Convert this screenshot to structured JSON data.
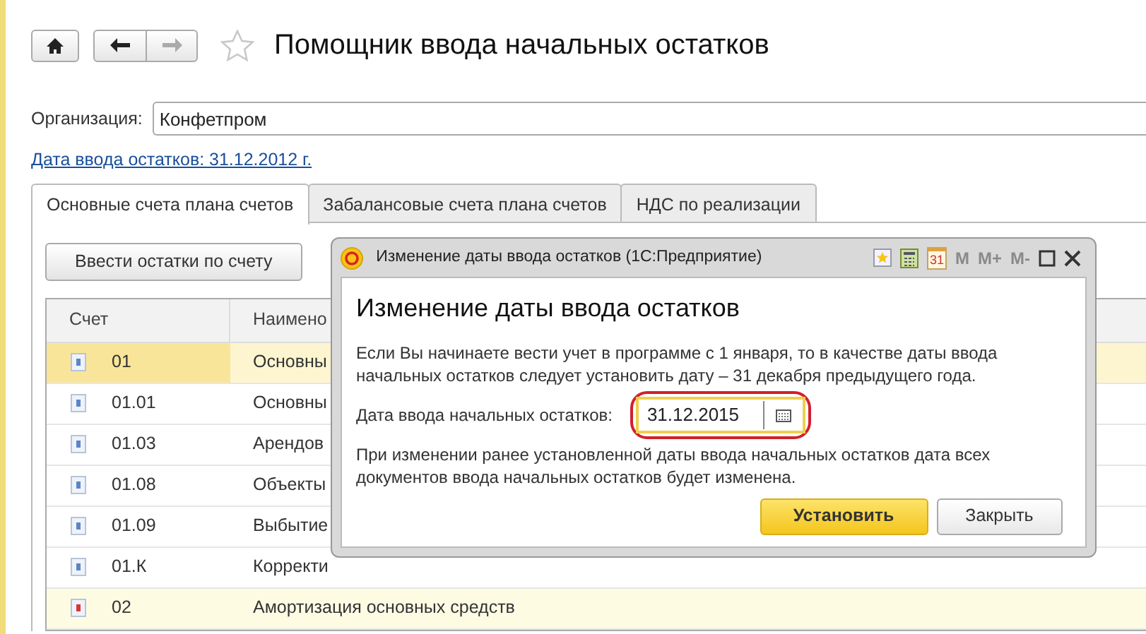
{
  "window": {
    "title": "Помощник ввода начальных остатков",
    "favorite": false,
    "forward_disabled": true
  },
  "organization": {
    "label": "Организация:",
    "value": "Конфетпром"
  },
  "date_link": "Дата ввода остатков: 31.12.2012 г.",
  "tabs": [
    {
      "label": "Основные счета плана счетов",
      "selected": true
    },
    {
      "label": "Забалансовые счета плана счетов",
      "selected": false
    },
    {
      "label": "НДС по реализации",
      "selected": false
    }
  ],
  "enter_button": "Ввести остатки по счету",
  "table": {
    "columns": [
      "Счет",
      "Наимено"
    ],
    "rows": [
      {
        "kind": "active",
        "account": "01",
        "name": "Основны",
        "selected": true,
        "group": true
      },
      {
        "kind": "active",
        "account": "01.01",
        "name": "Основны",
        "selected": false,
        "group": false
      },
      {
        "kind": "active",
        "account": "01.03",
        "name": "Арендов",
        "selected": false,
        "group": false
      },
      {
        "kind": "active",
        "account": "01.08",
        "name": "Объекты",
        "selected": false,
        "group": false
      },
      {
        "kind": "active",
        "account": "01.09",
        "name": "Выбытие",
        "selected": false,
        "group": false
      },
      {
        "kind": "active",
        "account": "01.К",
        "name": "Корректи",
        "selected": false,
        "group": false
      },
      {
        "kind": "passive",
        "account": "02",
        "name": "Амортизация основных средств",
        "selected": false,
        "group": true
      }
    ]
  },
  "dialog": {
    "title": "Изменение даты ввода остатков  (1С:Предприятие)",
    "calendar_day": "31",
    "memory_buttons": [
      {
        "label": "M",
        "disabled": true
      },
      {
        "label": "M+",
        "disabled": true
      },
      {
        "label": "M-",
        "disabled": true
      }
    ],
    "heading": "Изменение даты ввода остатков",
    "intro": "Если Вы начинаете вести учет в программе с 1 января, то в качестве даты ввода начальных остатков следует установить дату – 31 декабря предыдущего года.",
    "date_label": "Дата ввода начальных остатков:",
    "date_value": "31.12.2015",
    "date_highlighted": true,
    "note": "При изменении ранее установленной даты ввода начальных остатков дата всех документов ввода начальных остатков будет изменена.",
    "buttons": [
      {
        "label": "Установить",
        "kind": "primary"
      },
      {
        "label": "Закрыть",
        "kind": "default"
      }
    ]
  }
}
